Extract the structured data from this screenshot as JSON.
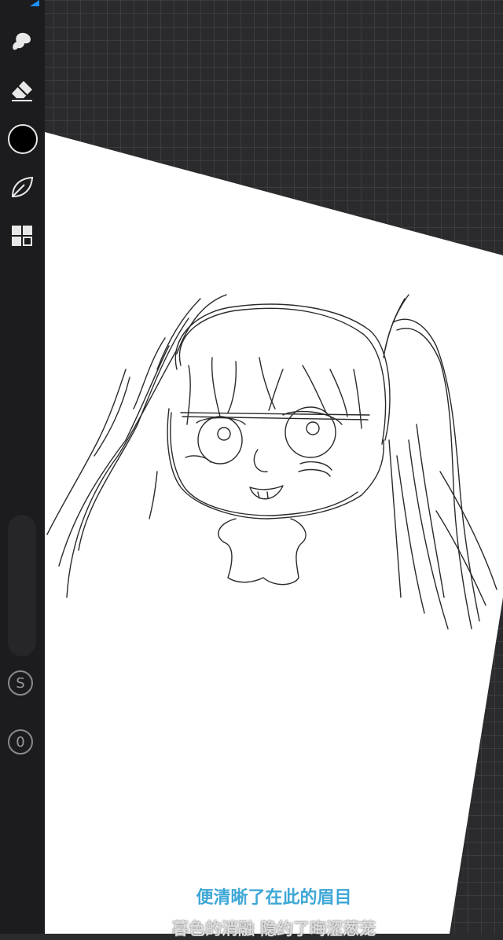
{
  "toolbar": {
    "tools": [
      {
        "name": "smudge",
        "icon": "smudge-icon"
      },
      {
        "name": "eraser",
        "icon": "eraser-icon"
      },
      {
        "name": "color",
        "icon": "color-swatch-icon"
      },
      {
        "name": "layers",
        "icon": "leaf-icon"
      },
      {
        "name": "gallery",
        "icon": "grid-icon"
      }
    ],
    "current_color": "#000000",
    "accent_color": "#1e90ff",
    "brush_size_button_label": "S",
    "opacity_button_label": "0"
  },
  "subtitles": {
    "line1": "便清晰了在此的眉目",
    "line2": "暮色的消融 隐约了晦涩葱茏"
  }
}
